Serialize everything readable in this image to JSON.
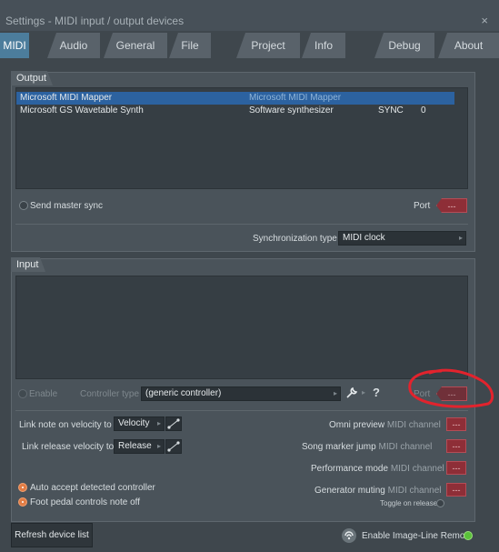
{
  "window": {
    "title": "Settings - MIDI input / output devices",
    "close_glyph": "×"
  },
  "tabs": [
    {
      "label": "MIDI",
      "active": true
    },
    {
      "label": "Audio"
    },
    {
      "label": "General"
    },
    {
      "label": "File"
    },
    {
      "label": "Project"
    },
    {
      "label": "Info"
    },
    {
      "label": "Debug"
    },
    {
      "label": "About"
    }
  ],
  "output": {
    "section_label": "Output",
    "devices": [
      {
        "name": "Microsoft MIDI Mapper",
        "description": "Microsoft MIDI Mapper",
        "sync": "",
        "port": ""
      },
      {
        "name": "Microsoft GS Wavetable Synth",
        "description": "Software synthesizer",
        "sync": "SYNC",
        "port": "0"
      }
    ],
    "send_master_sync": "Send master sync",
    "port_label": "Port",
    "port_value": "---",
    "sync_type_label": "Synchronization type",
    "sync_type_value": "MIDI clock"
  },
  "input": {
    "section_label": "Input",
    "enable_label": "Enable",
    "controller_type_label": "Controller type",
    "controller_type_value": "(generic controller)",
    "help_glyph": "?",
    "port_label": "Port",
    "port_value": "---",
    "link_velocity_label": "Link note on velocity to",
    "link_velocity_value": "Velocity",
    "link_release_label": "Link release velocity to",
    "link_release_value": "Release",
    "omni_preview_label": "Omni preview",
    "song_marker_label": "Song marker jump",
    "performance_mode_label": "Performance mode",
    "generator_muting_label": "Generator muting",
    "midi_channel_label": "MIDI channel",
    "channel_value": "---",
    "toggle_on_release": "Toggle on release",
    "auto_accept": "Auto accept detected controller",
    "foot_pedal": "Foot pedal controls note off"
  },
  "footer": {
    "refresh_button": "Refresh device list",
    "remote_label": "Enable Image-Line Remote"
  },
  "colors": {
    "accent": "#4c7d9c",
    "port_button": "#8e2e37",
    "annotation": "#e2232d"
  }
}
